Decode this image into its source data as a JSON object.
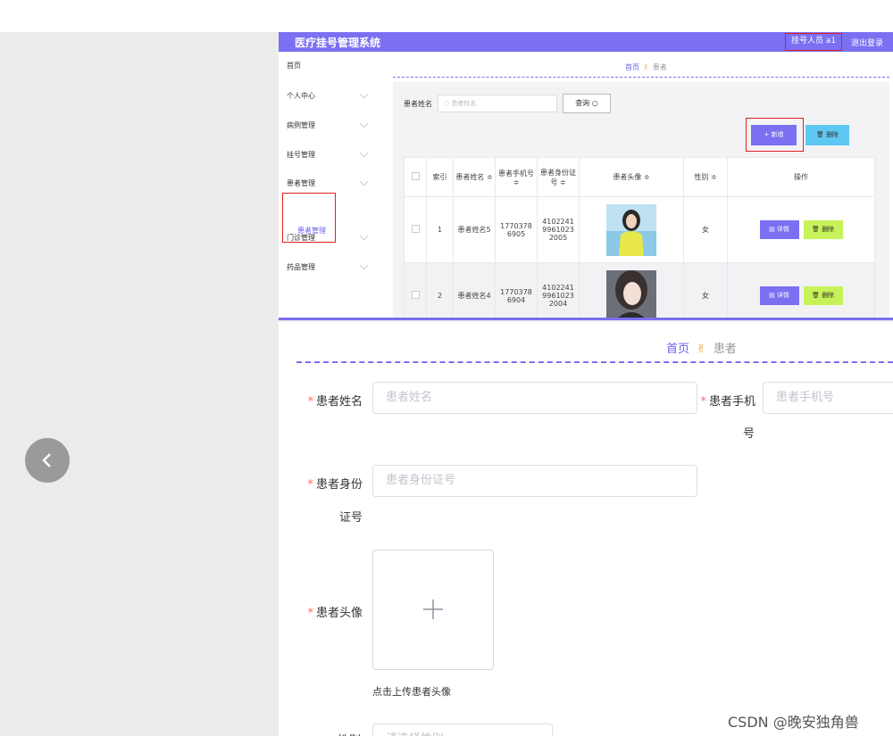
{
  "app": {
    "title": "医疗挂号管理系统",
    "user_label": "挂号人员 a1",
    "logout_label": "退出登录"
  },
  "sidebar": {
    "items": [
      {
        "label": "首页",
        "has_caret": false
      },
      {
        "label": "个人中心",
        "has_caret": true
      },
      {
        "label": "病例管理",
        "has_caret": true
      },
      {
        "label": "挂号管理",
        "has_caret": true
      },
      {
        "label": "患者管理",
        "has_caret": true
      },
      {
        "label": "门诊管理",
        "has_caret": true
      },
      {
        "label": "药品管理",
        "has_caret": true
      }
    ],
    "active_sub": "患者管理"
  },
  "list_page": {
    "breadcrumb": {
      "home": "首页",
      "current": "患者"
    },
    "search_label": "患者姓名",
    "search_placeholder": "患者姓名",
    "search_button": "查询",
    "add_button": "+ 新增",
    "delete_button": "删除",
    "columns": [
      "索引",
      "患者姓名 ≑",
      "患者手机号 ≑",
      "患者身份证号 ≑",
      "患者头像 ≑",
      "性别 ≑",
      "操作"
    ],
    "rows": [
      {
        "index": "1",
        "name": "患者姓名5",
        "phone": "17703786905",
        "id_no": "410224199610232005",
        "gender": "女"
      },
      {
        "index": "2",
        "name": "患者姓名4",
        "phone": "17703786904",
        "id_no": "410224199610232004",
        "gender": "女"
      }
    ],
    "detail_button": "详情",
    "row_delete_button": "删除"
  },
  "form_page": {
    "breadcrumb": {
      "home": "首页",
      "current": "患者"
    },
    "name_label": "患者姓名",
    "name_placeholder": "患者姓名",
    "phone_label_1": "患者手机",
    "phone_label_2": "号",
    "phone_placeholder": "患者手机号",
    "id_label_1": "患者身份",
    "id_label_2": "证号",
    "id_placeholder": "患者身份证号",
    "avatar_label": "患者头像",
    "upload_hint": "点击上传患者头像",
    "gender_label": "性别",
    "gender_placeholder": "请选择性别"
  },
  "watermark": "CSDN @晚安独角兽",
  "colors": {
    "primary": "#7b6ff2",
    "danger_outline": "#e02020",
    "info": "#5ec8f2",
    "lime": "#c8f25a"
  }
}
